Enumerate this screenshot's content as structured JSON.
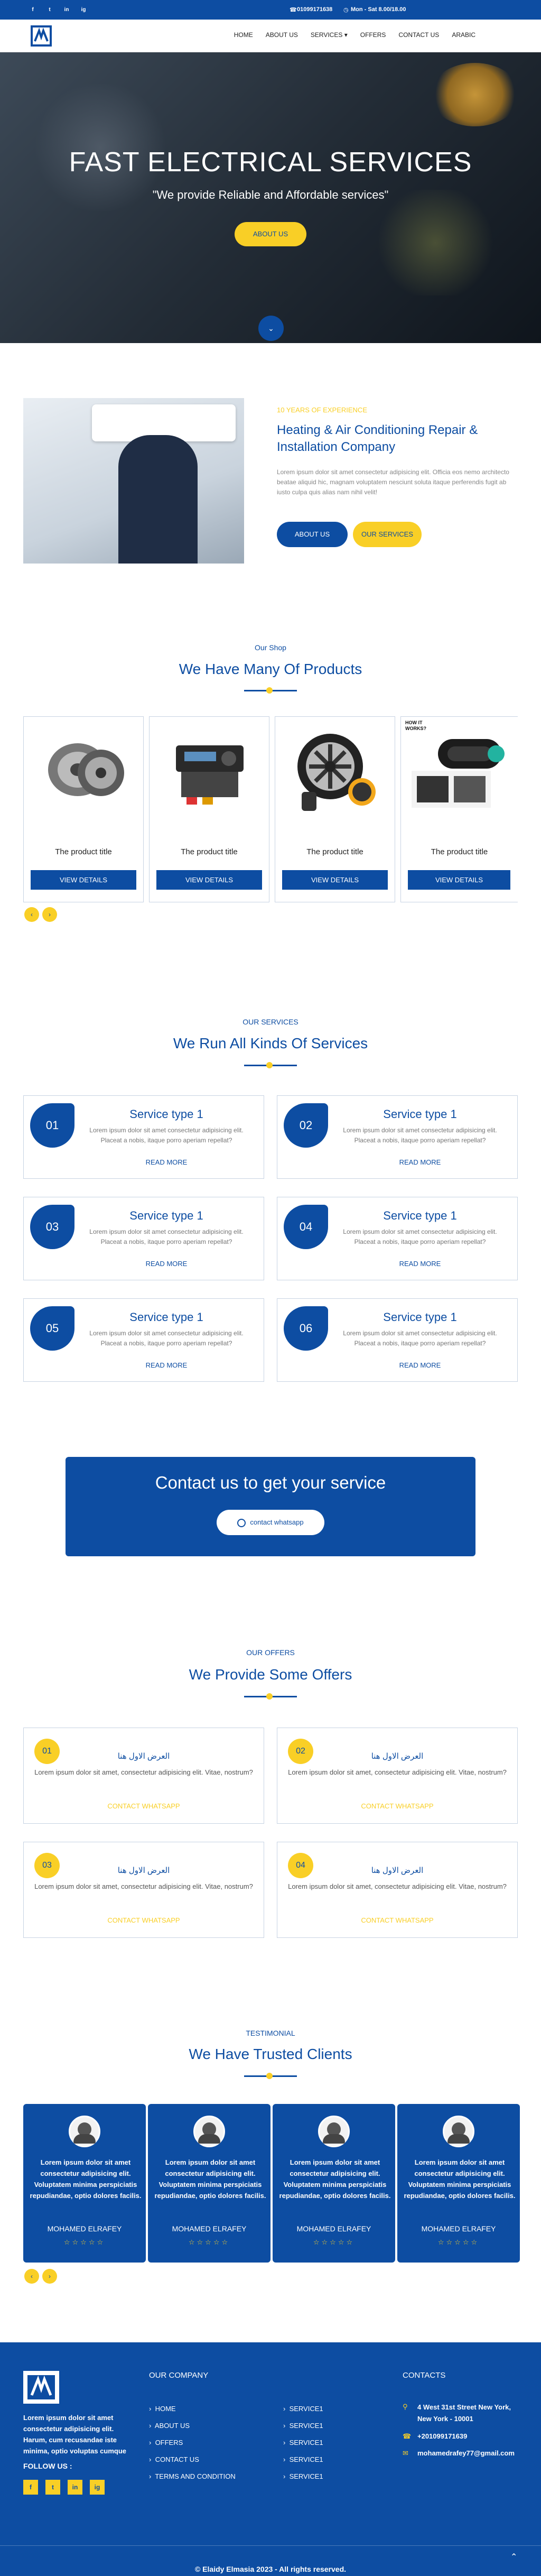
{
  "topbar": {
    "social": [
      "f",
      "t",
      "in",
      "ig"
    ],
    "phone": "01099171638",
    "hours": "Mon - Sat 8.00/18.00"
  },
  "nav": {
    "items": [
      "HOME",
      "ABOUT US",
      "SERVICES",
      "OFFERS",
      "CONTACT US",
      "ARABIC"
    ],
    "caret": "▾"
  },
  "hero": {
    "title": "FAST ELECTRICAL SERVICES",
    "subtitle": "\"We provide Reliable and Affordable services\"",
    "button": "ABOUT US",
    "down": "⌄"
  },
  "about": {
    "eyebrow": "10 YEARS OF EXPERIENCE",
    "title": "Heating & Air Conditioning Repair & Installation Company",
    "body": "Lorem ipsum dolor sit amet consectetur adipisicing elit. Officia eos nemo architecto beatae aliquid hic, magnam voluptatem nesciunt soluta itaque perferendis fugit ab iusto culpa quis alias nam nihil velit!",
    "btn_about": "ABOUT US",
    "btn_services": "OUR SERVICES"
  },
  "shop": {
    "label": "Our Shop",
    "title": "We Have Many Of Products",
    "products": [
      {
        "title": "The product title",
        "button": "VIEW DETAILS"
      },
      {
        "title": "The product title",
        "button": "VIEW DETAILS"
      },
      {
        "title": "The product title",
        "button": "VIEW DETAILS"
      },
      {
        "title": "The product title",
        "button": "VIEW DETAILS"
      }
    ],
    "prev": "‹",
    "next": "›",
    "badge": "HOW IT WORKS?"
  },
  "services": {
    "label": "OUR SERVICES",
    "title": "We Run All Kinds Of Services",
    "items": [
      {
        "num": "01",
        "title": "Service type 1",
        "desc": "Lorem ipsum dolor sit amet consectetur adipisicing elit. Placeat a nobis, itaque porro aperiam repellat?",
        "more": "READ MORE"
      },
      {
        "num": "02",
        "title": "Service type 1",
        "desc": "Lorem ipsum dolor sit amet consectetur adipisicing elit. Placeat a nobis, itaque porro aperiam repellat?",
        "more": "READ MORE"
      },
      {
        "num": "03",
        "title": "Service type 1",
        "desc": "Lorem ipsum dolor sit amet consectetur adipisicing elit. Placeat a nobis, itaque porro aperiam repellat?",
        "more": "READ MORE"
      },
      {
        "num": "04",
        "title": "Service type 1",
        "desc": "Lorem ipsum dolor sit amet consectetur adipisicing elit. Placeat a nobis, itaque porro aperiam repellat?",
        "more": "READ MORE"
      },
      {
        "num": "05",
        "title": "Service type 1",
        "desc": "Lorem ipsum dolor sit amet consectetur adipisicing elit. Placeat a nobis, itaque porro aperiam repellat?",
        "more": "READ MORE"
      },
      {
        "num": "06",
        "title": "Service type 1",
        "desc": "Lorem ipsum dolor sit amet consectetur adipisicing elit. Placeat a nobis, itaque porro aperiam repellat?",
        "more": "READ MORE"
      }
    ]
  },
  "cta": {
    "title": "Contact us to get your service",
    "button": "contact whatsapp"
  },
  "offers": {
    "label": "OUR OFFERS",
    "title": "We Provide Some Offers",
    "items": [
      {
        "num": "01",
        "title": "العرض الاول هنا",
        "desc": "Lorem ipsum dolor sit amet, consectetur adipisicing elit. Vitae, nostrum?",
        "link": "CONTACT WHATSAPP"
      },
      {
        "num": "02",
        "title": "العرض الاول هنا",
        "desc": "Lorem ipsum dolor sit amet, consectetur adipisicing elit. Vitae, nostrum?",
        "link": "CONTACT WHATSAPP"
      },
      {
        "num": "03",
        "title": "العرض الاول هنا",
        "desc": "Lorem ipsum dolor sit amet, consectetur adipisicing elit. Vitae, nostrum?",
        "link": "CONTACT WHATSAPP"
      },
      {
        "num": "04",
        "title": "العرض الاول هنا",
        "desc": "Lorem ipsum dolor sit amet, consectetur adipisicing elit. Vitae, nostrum?",
        "link": "CONTACT WHATSAPP"
      }
    ]
  },
  "testimonials": {
    "label": "TESTIMONIAL",
    "title": "We Have Trusted Clients",
    "items": [
      {
        "text": "Lorem ipsum dolor sit amet consectetur adipisicing elit. Voluptatem minima perspiciatis repudiandae, optio dolores facilis.",
        "name": "MOHAMED ELRAFEY",
        "stars": "☆☆☆☆☆"
      },
      {
        "text": "Lorem ipsum dolor sit amet consectetur adipisicing elit. Voluptatem minima perspiciatis repudiandae, optio dolores facilis.",
        "name": "MOHAMED ELRAFEY",
        "stars": "☆☆☆☆☆"
      },
      {
        "text": "Lorem ipsum dolor sit amet consectetur adipisicing elit. Voluptatem minima perspiciatis repudiandae, optio dolores facilis.",
        "name": "MOHAMED ELRAFEY",
        "stars": "☆☆☆☆☆"
      },
      {
        "text": "Lorem ipsum dolor sit amet consectetur adipisicing elit. Voluptatem minima perspiciatis repudiandae, optio dolores facilis.",
        "name": "MOHAMED ELRAFEY",
        "stars": "☆☆☆☆☆"
      }
    ]
  },
  "footer": {
    "about": "Lorem ipsum dolor sit amet consectetur adipisicing elit. Harum, cum recusandae iste minima, optio voluptas cumque",
    "follow": "FOLLOW US :",
    "company_heading": "OUR COMPANY",
    "links": [
      "HOME",
      "ABOUT US",
      "OFFERS",
      "CONTACT US",
      "TERMS AND CONDITION"
    ],
    "services": [
      "SERVICE1",
      "SERVICE1",
      "SERVICE1",
      "SERVICE1",
      "SERVICE1"
    ],
    "contacts_heading": "CONTACTS",
    "address": "4 West 31st Street New York, New York - 10001",
    "phone": "+201099171639",
    "email": "mohamedrafey77@gmail.com",
    "copyright": "© Elaidy Elmasia 2023 - All rights reserved.",
    "up": "⌃"
  },
  "colors": {
    "primary": "#0d4da2",
    "accent": "#f9cf26"
  }
}
